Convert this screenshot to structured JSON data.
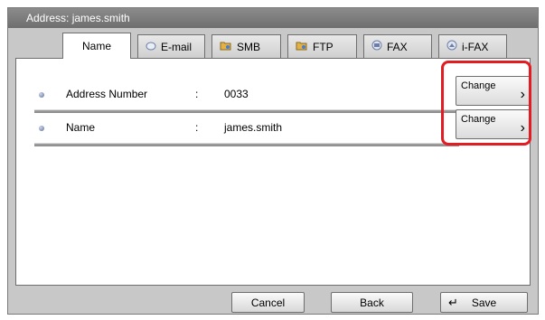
{
  "window": {
    "title": "Address: james.smith"
  },
  "tabs": [
    {
      "label": "Name",
      "icon": "none"
    },
    {
      "label": "E-mail",
      "icon": "envelope-icon"
    },
    {
      "label": "SMB",
      "icon": "folder-icon"
    },
    {
      "label": "FTP",
      "icon": "folder-icon"
    },
    {
      "label": "FAX",
      "icon": "fax-icon"
    },
    {
      "label": "i-FAX",
      "icon": "ifax-icon"
    }
  ],
  "fields": [
    {
      "label": "Address Number",
      "separator": ":",
      "value": "0033",
      "button": "Change"
    },
    {
      "label": "Name",
      "separator": ":",
      "value": "james.smith",
      "button": "Change"
    }
  ],
  "footer": {
    "cancel": "Cancel",
    "back": "Back",
    "save": "Save"
  },
  "colors": {
    "highlight": "#e31b23",
    "title_bar": "#7a7a7a",
    "frame": "#c8c8c8"
  }
}
